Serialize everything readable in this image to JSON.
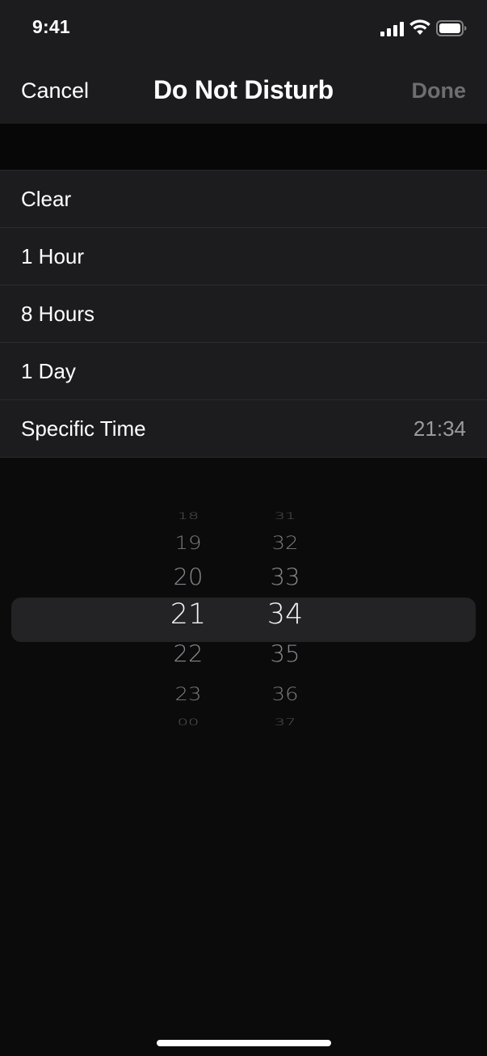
{
  "status_bar": {
    "time": "9:41",
    "icons": [
      "signal-icon",
      "wifi-icon",
      "battery-icon"
    ]
  },
  "nav": {
    "cancel_label": "Cancel",
    "title": "Do Not Disturb",
    "done_label": "Done"
  },
  "options": [
    {
      "label": "Clear",
      "value": ""
    },
    {
      "label": "1 Hour",
      "value": ""
    },
    {
      "label": "8 Hours",
      "value": ""
    },
    {
      "label": "1 Day",
      "value": ""
    },
    {
      "label": "Specific Time",
      "value": "21:34"
    }
  ],
  "picker": {
    "hours": {
      "above": [
        "18",
        "19",
        "20"
      ],
      "selected": "21",
      "below": [
        "22",
        "23",
        "00"
      ]
    },
    "minutes": {
      "above": [
        "31",
        "32",
        "33"
      ],
      "selected": "34",
      "below": [
        "35",
        "36",
        "37"
      ]
    }
  },
  "colors": {
    "background": "#0b0b0b",
    "surface": "#1c1c1e",
    "text_primary": "#ffffff",
    "text_secondary": "#9a9aa0",
    "done_disabled": "#6e6e72",
    "picker_highlight": "#232325"
  }
}
